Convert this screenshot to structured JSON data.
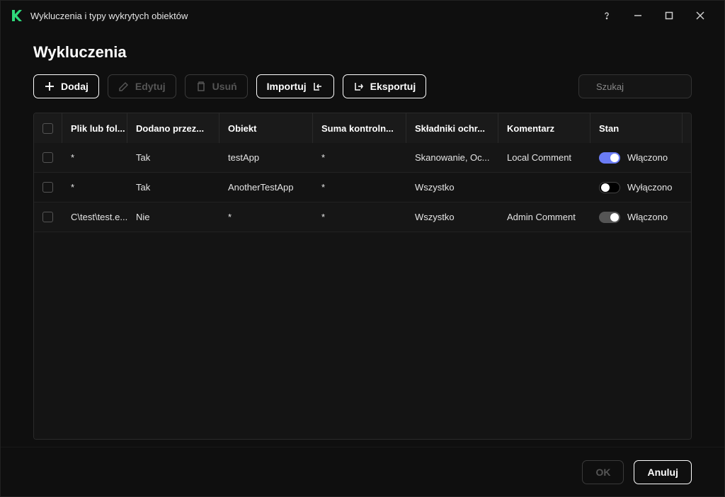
{
  "window": {
    "title": "Wykluczenia i typy wykrytych obiektów"
  },
  "page": {
    "heading": "Wykluczenia"
  },
  "toolbar": {
    "add": "Dodaj",
    "edit": "Edytuj",
    "delete": "Usuń",
    "import": "Importuj",
    "export": "Eksportuj"
  },
  "search": {
    "placeholder": "Szukaj"
  },
  "table": {
    "headers": {
      "file": "Plik lub fol...",
      "added": "Dodano przez...",
      "object": "Obiekt",
      "checksum": "Suma kontroln...",
      "components": "Składniki ochr...",
      "comment": "Komentarz",
      "state": "Stan"
    },
    "state_labels": {
      "on": "Włączono",
      "off": "Wyłączono"
    },
    "rows": [
      {
        "file": "*",
        "added": "Tak",
        "object": "testApp",
        "checksum": "*",
        "components": "Skanowanie, Oc...",
        "comment": "Local Comment",
        "state_on": true,
        "toggle_color": "blue"
      },
      {
        "file": "*",
        "added": "Tak",
        "object": "AnotherTestApp",
        "checksum": "*",
        "components": "Wszystko",
        "comment": "",
        "state_on": false,
        "toggle_color": "off"
      },
      {
        "file": "C\\test\\test.e...",
        "added": "Nie",
        "object": "*",
        "checksum": "*",
        "components": "Wszystko",
        "comment": "Admin Comment",
        "state_on": true,
        "toggle_color": "grey"
      }
    ]
  },
  "footer": {
    "ok": "OK",
    "cancel": "Anuluj"
  }
}
